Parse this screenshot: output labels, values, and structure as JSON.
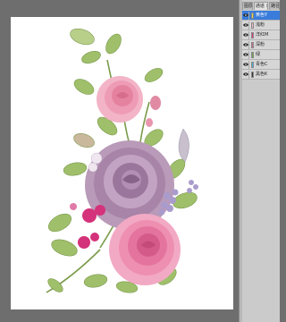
{
  "panel": {
    "tabs": [
      {
        "label": "图层",
        "active": false
      },
      {
        "label": "通道 ×",
        "active": true
      },
      {
        "label": "路径",
        "active": false
      }
    ],
    "channels": [
      {
        "label": "黄色Y",
        "selected": true,
        "swatch": "#e6d64a"
      },
      {
        "label": "浅粉",
        "selected": false,
        "swatch": "#f2b6c4"
      },
      {
        "label": "洋红M",
        "selected": false,
        "swatch": "#d8437f"
      },
      {
        "label": "深粉",
        "selected": false,
        "swatch": "#c96e8e"
      },
      {
        "label": "绿",
        "selected": false,
        "swatch": "#6aa84f"
      },
      {
        "label": "青色C",
        "selected": false,
        "swatch": "#4fb3d9"
      },
      {
        "label": "黑色K",
        "selected": false,
        "swatch": "#333333"
      }
    ]
  },
  "document": {
    "artwork": "rose-bouquet-illustration"
  }
}
